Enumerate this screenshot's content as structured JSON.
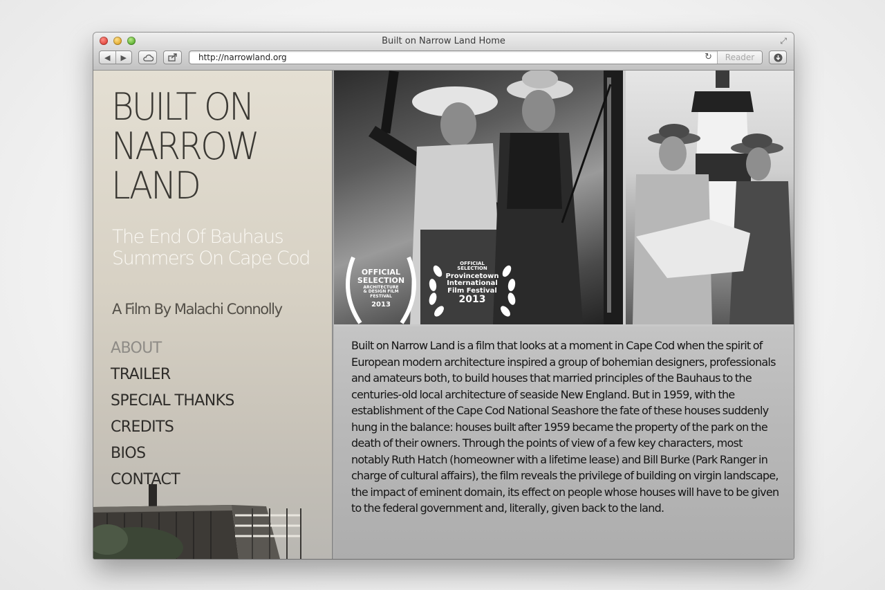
{
  "browser": {
    "window_title": "Built on Narrow Land Home",
    "url": "http://narrowland.org",
    "reader_label": "Reader"
  },
  "site": {
    "title": "BUILT ON NARROW LAND",
    "subtitle": "The End Of Bauhaus Summers On Cape Cod",
    "byline": "A Film By Malachi Connolly",
    "nav": [
      {
        "label": "ABOUT",
        "active": true
      },
      {
        "label": "TRAILER",
        "active": false
      },
      {
        "label": "SPECIAL THANKS",
        "active": false
      },
      {
        "label": "CREDITS",
        "active": false
      },
      {
        "label": "BIOS",
        "active": false
      },
      {
        "label": "CONTACT",
        "active": false
      }
    ]
  },
  "laurels": [
    {
      "line1": "OFFICIAL",
      "line2": "SELECTION",
      "line3": "ARCHITECTURE & DESIGN FILM FESTIVAL",
      "year": "2013"
    },
    {
      "line1": "OFFICIAL SELECTION",
      "line2": "Provincetown International Film Festival",
      "year": "2013"
    }
  ],
  "about": {
    "text": "Built on Narrow Land is a film that looks at a moment in Cape Cod when the spirit of European modern architecture inspired a group of bohemian designers, professionals and amateurs both, to build houses that married principles of the Bauhaus to the centuries-old local architecture of seaside New England. But in 1959, with the establishment of the Cape Cod National Seashore the fate of these houses suddenly hung in the balance: houses built after 1959 became the property of the park on the death of their owners. Through the points of view of a few key characters, most notably Ruth Hatch (homeowner with a lifetime lease) and Bill Burke (Park Ranger in charge of cultural affairs), the film reveals the privilege of building on virgin landscape, the impact of eminent domain, its effect on people whose houses will have to be given to the federal government and, literally, given back to the land."
  },
  "icons": [
    "back-icon",
    "forward-icon",
    "icloud-icon",
    "share-icon",
    "reload-icon",
    "download-icon",
    "fullscreen-icon"
  ]
}
